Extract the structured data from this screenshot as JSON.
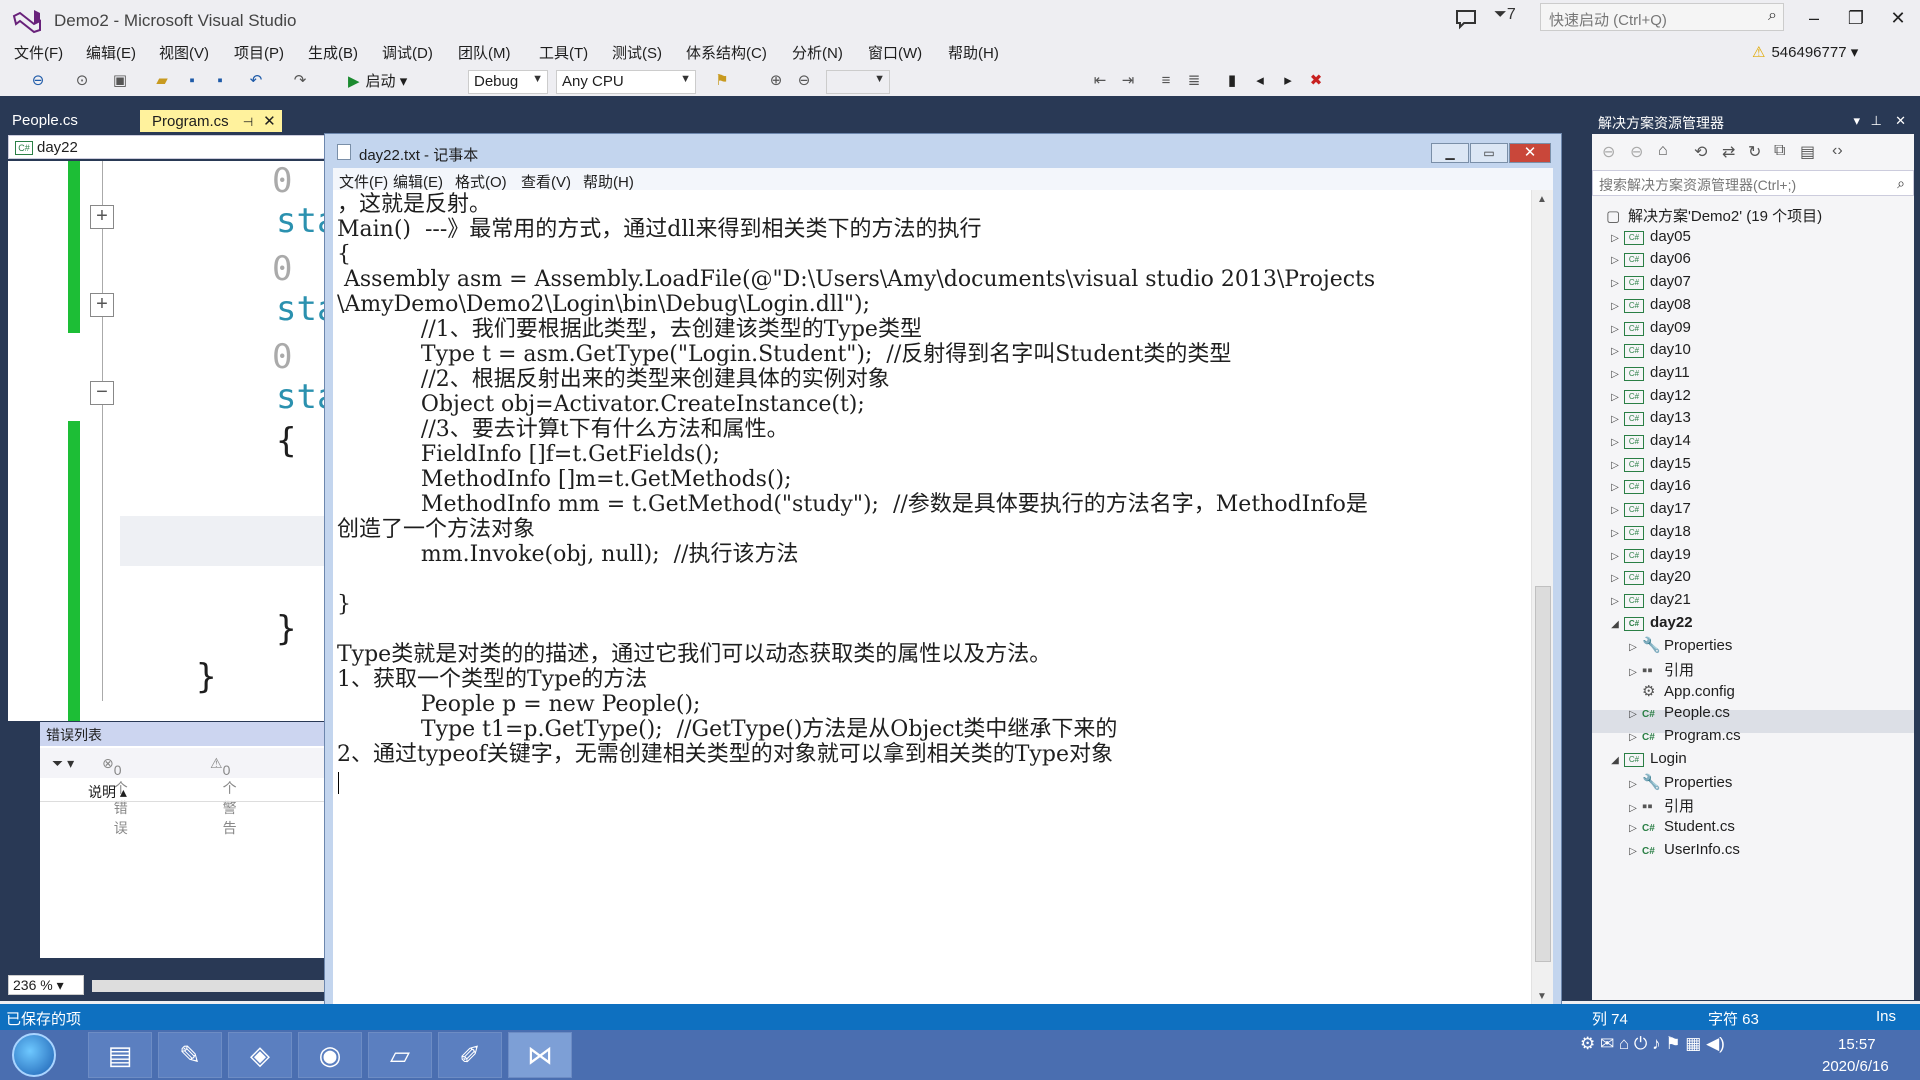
{
  "window": {
    "title": "Demo2 - Microsoft Visual Studio",
    "filter_count": "7",
    "quick_launch_placeholder": "快速启动 (Ctrl+Q)"
  },
  "menu": [
    "文件(F)",
    "编辑(E)",
    "视图(V)",
    "项目(P)",
    "生成(B)",
    "调试(D)",
    "团队(M)",
    "工具(T)",
    "测试(S)",
    "体系结构(C)",
    "分析(N)",
    "窗口(W)",
    "帮助(H)"
  ],
  "user": {
    "name": "546496777"
  },
  "toolbar": {
    "start_label": "启动",
    "config": "Debug",
    "platform": "Any CPU"
  },
  "doc_tabs": {
    "people": "People.cs",
    "program": "Program.cs"
  },
  "nav": {
    "class_name": "day22"
  },
  "code": {
    "refs": [
      "0",
      "0",
      "0"
    ],
    "sta": [
      "sta",
      "sta",
      "sta"
    ],
    "open_brace": "{",
    "close_brace_1": "}",
    "close_brace_2": "}"
  },
  "error_list": {
    "title": "错误列表",
    "errors": "0 个错误",
    "warnings": "0 个警告",
    "column_desc": "说明"
  },
  "zoom": "236 %",
  "notepad": {
    "title": "day22.txt - 记事本",
    "menu": [
      "文件(F)",
      "编辑(E)",
      "格式(O)",
      "查看(V)",
      "帮助(H)"
    ],
    "lines": [
      "，这就是反射。",
      "Main()  ---》最常用的方式，通过dll来得到相关类下的方法的执行",
      "{",
      " Assembly asm = Assembly.LoadFile(@\"D:\\Users\\Amy\\documents\\visual studio 2013\\Projects",
      "\\AmyDemo\\Demo2\\Login\\bin\\Debug\\Login.dll\");",
      "            //1、我们要根据此类型，去创建该类型的Type类型",
      "            Type t = asm.GetType(\"Login.Student\");  //反射得到名字叫Student类的类型",
      "            //2、根据反射出来的类型来创建具体的实例对象",
      "            Object obj=Activator.CreateInstance(t);",
      "            //3、要去计算t下有什么方法和属性。",
      "            FieldInfo []f=t.GetFields();",
      "            MethodInfo []m=t.GetMethods();",
      "            MethodInfo mm = t.GetMethod(\"study\");  //参数是具体要执行的方法名字，MethodInfo是",
      "创造了一个方法对象",
      "            mm.Invoke(obj, null);  //执行该方法",
      "",
      "}",
      "",
      "Type类就是对类的的描述，通过它我们可以动态获取类的属性以及方法。",
      "1、获取一个类型的Type的方法",
      "            People p = new People();",
      "            Type t1=p.GetType();  //GetType()方法是从Object类中继承下来的",
      "2、通过typeof关键字，无需创建相关类型的对象就可以拿到相关类的Type对象"
    ]
  },
  "solution_explorer": {
    "title": "解决方案资源管理器",
    "search_placeholder": "搜索解决方案资源管理器(Ctrl+;)",
    "solution": "解决方案'Demo2' (19 个项目)",
    "projects": [
      "day05",
      "day06",
      "day07",
      "day08",
      "day09",
      "day10",
      "day11",
      "day12",
      "day13",
      "day14",
      "day15",
      "day16",
      "day17",
      "day18",
      "day19",
      "day20",
      "day21"
    ],
    "day22": {
      "name": "day22",
      "children": [
        "Properties",
        "引用",
        "App.config",
        "People.cs",
        "Program.cs"
      ]
    },
    "login": {
      "name": "Login",
      "children": [
        "Properties",
        "引用",
        "Student.cs",
        "UserInfo.cs"
      ]
    }
  },
  "status": {
    "left": "已保存的项",
    "col": "列 74",
    "char": "字符 63",
    "mode": "Ins"
  },
  "clock": {
    "time": "15:57",
    "date": "2020/6/16"
  },
  "colors": {
    "vs_accent": "#293955",
    "status_blue": "#0e70c0",
    "change_green": "#1dbe36",
    "tab_active": "#fff29d"
  },
  "icons": [
    "vs-logo-icon",
    "notification-icon",
    "filter-icon",
    "search-icon",
    "minimize-icon",
    "restore-icon",
    "close-icon",
    "play-icon",
    "pin-icon",
    "cs-file-icon",
    "wrench-icon",
    "references-icon",
    "config-icon",
    "home-icon",
    "warning-icon",
    "windows-start-icon"
  ]
}
